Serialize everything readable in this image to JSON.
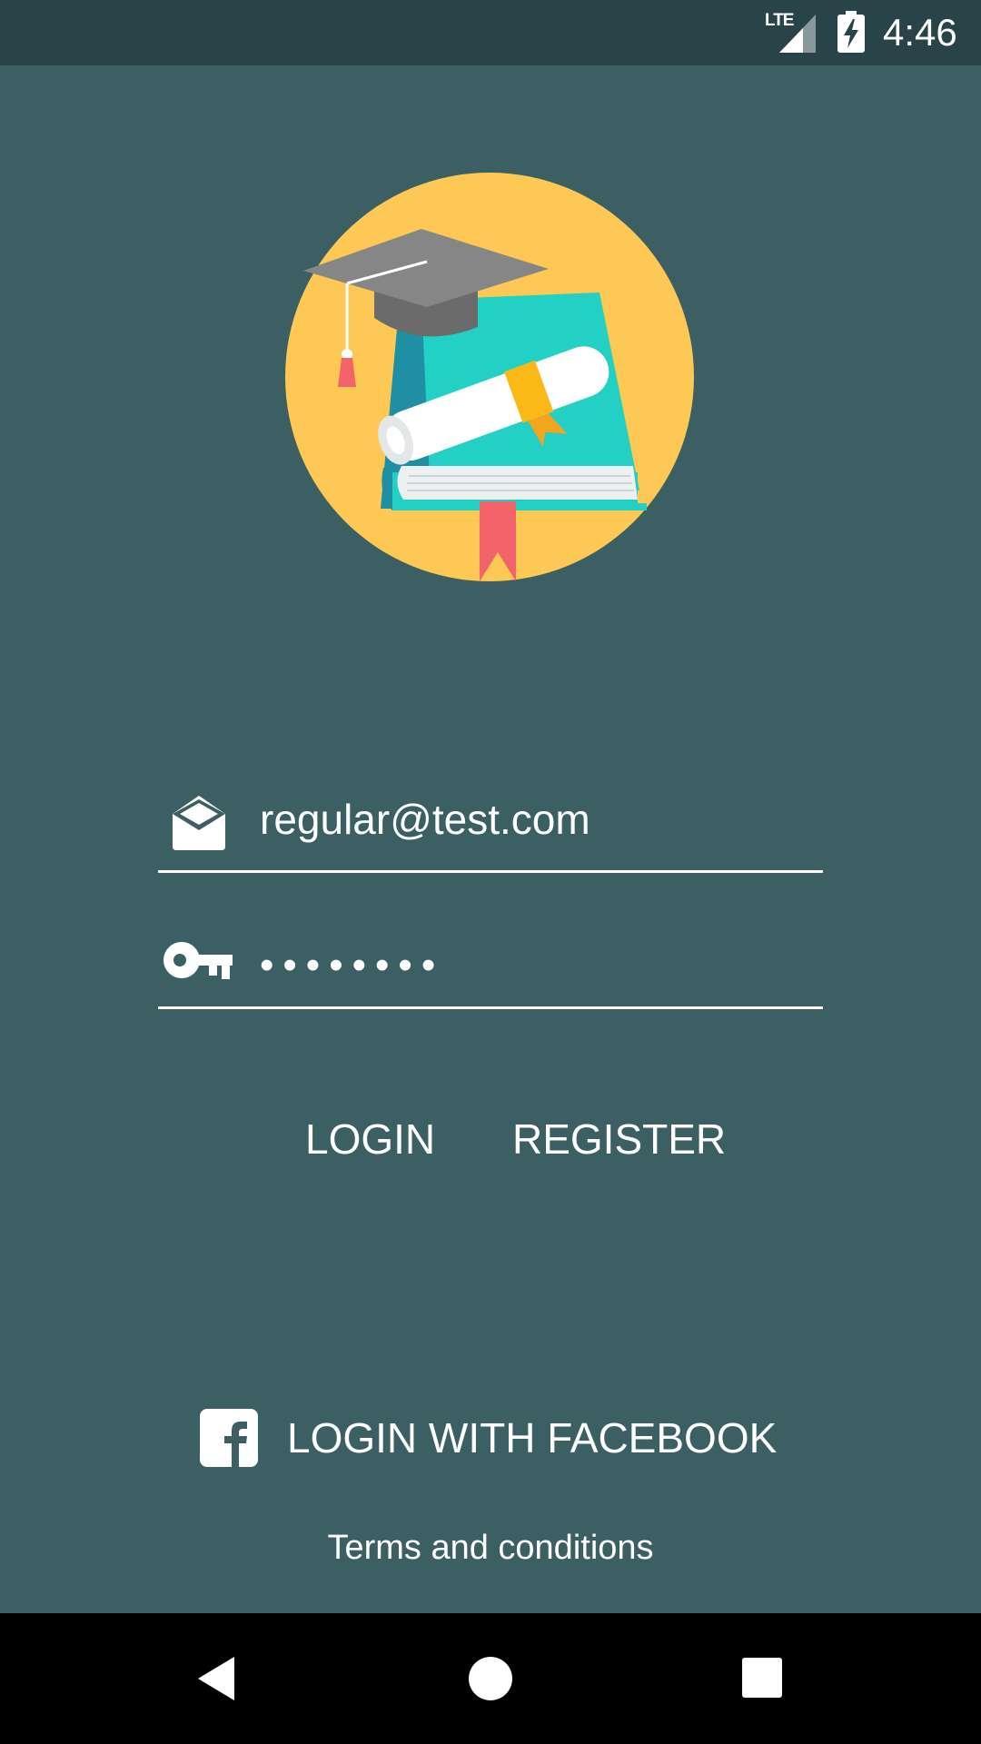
{
  "status_bar": {
    "network": "LTE",
    "time": "4:46"
  },
  "login_form": {
    "email_value": "regular@test.com",
    "password_value": "12345678"
  },
  "actions": {
    "login_label": "LOGIN",
    "register_label": "REGISTER",
    "facebook_label": "LOGIN WITH FACEBOOK",
    "terms_label": "Terms and conditions"
  },
  "icons": {
    "email": "envelope-open-icon",
    "password": "key-icon",
    "facebook": "facebook-icon",
    "logo": "graduation-cap-books-diploma-logo"
  },
  "colors": {
    "background": "#3b5f63",
    "status_bar": "#284448",
    "logo_circle": "#fdc853",
    "text": "#ffffff"
  }
}
